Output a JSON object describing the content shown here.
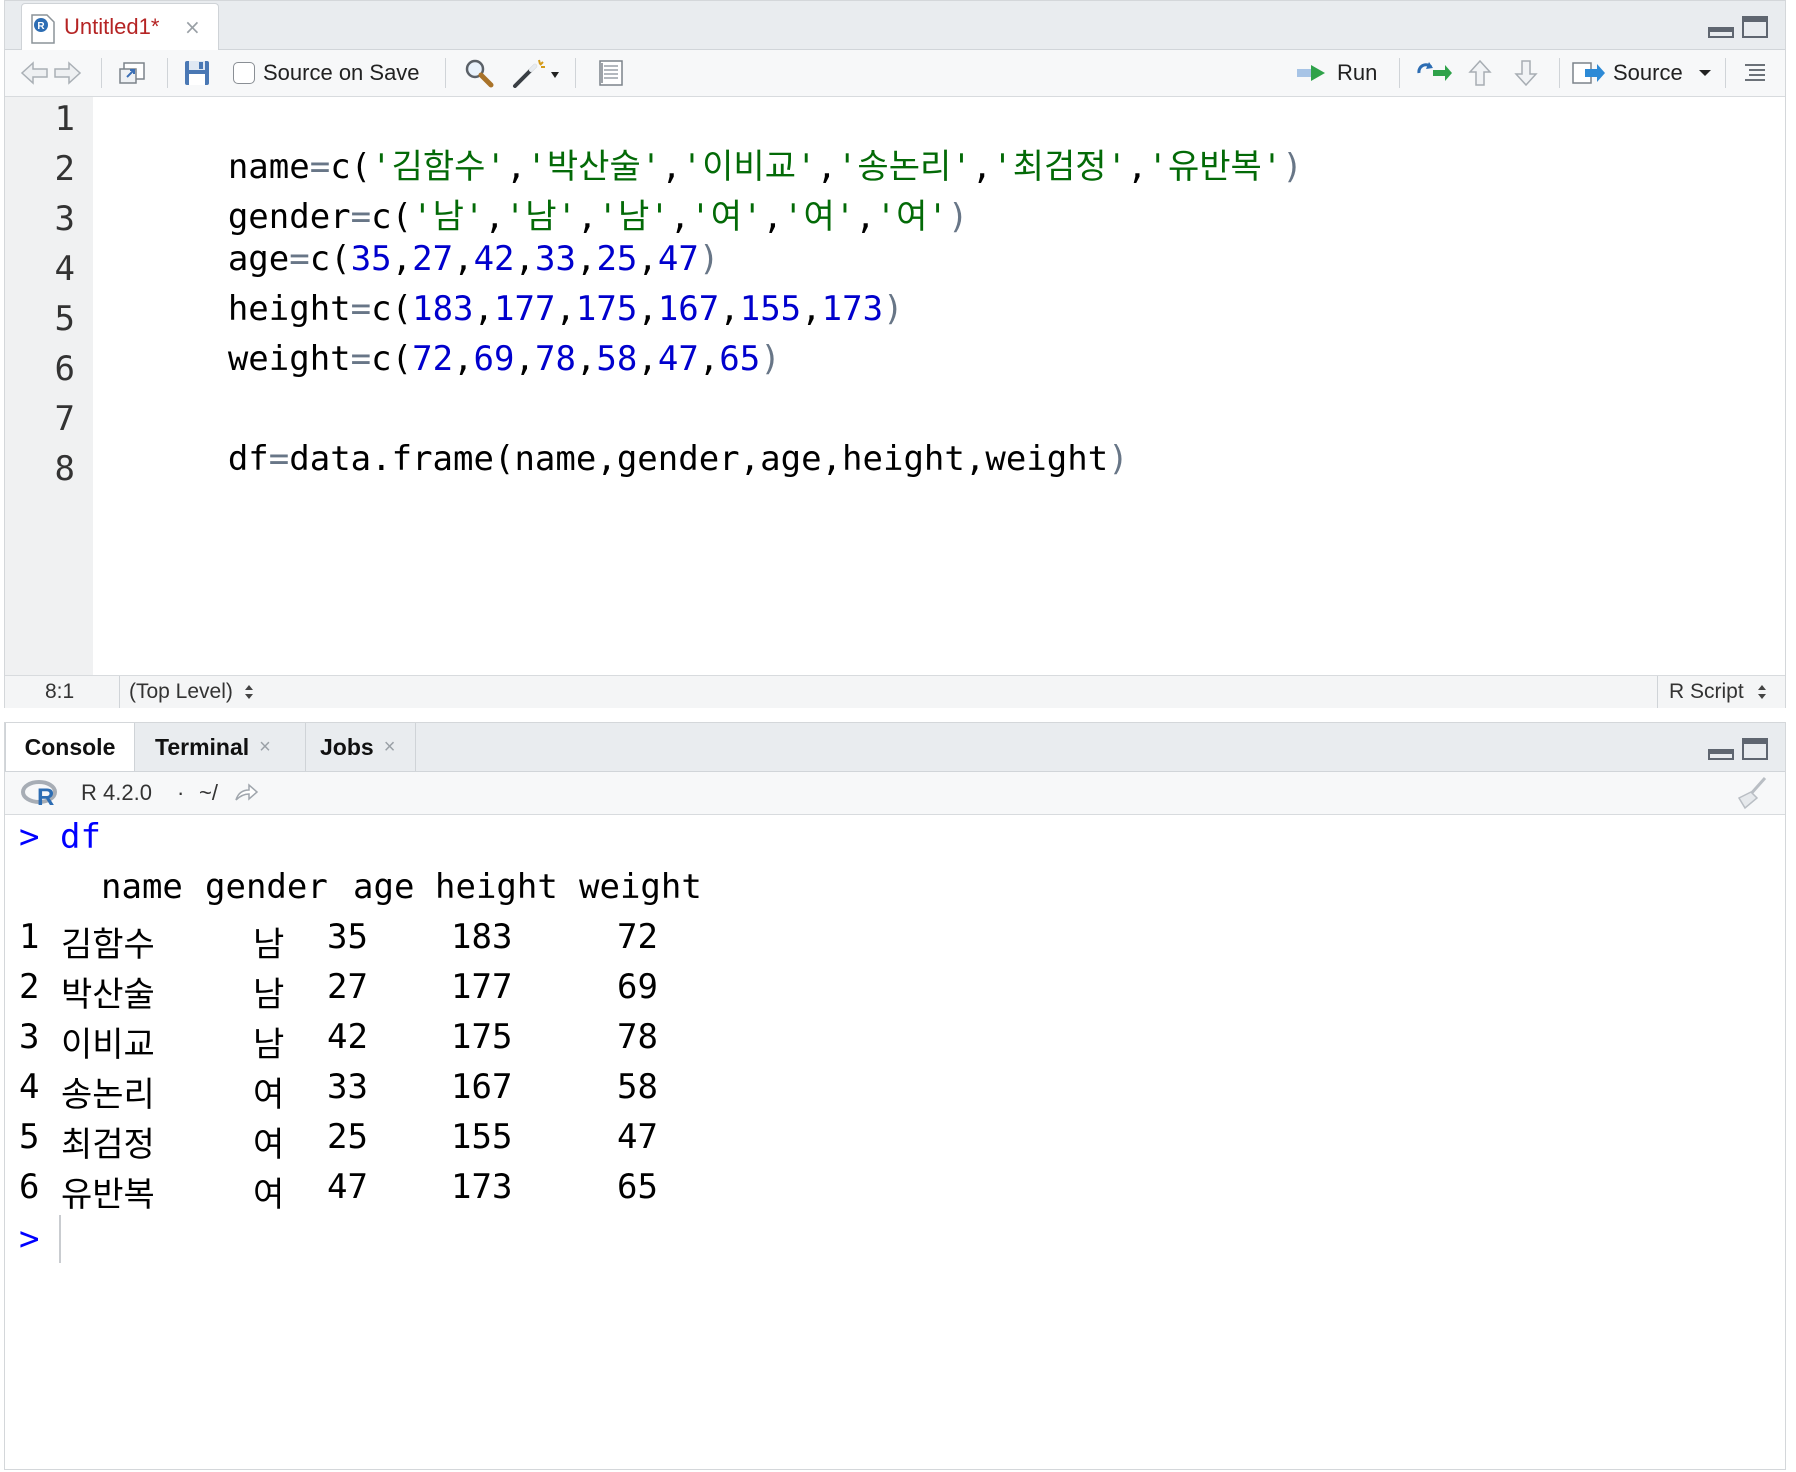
{
  "source_pane": {
    "tab": {
      "title": "Untitled1*",
      "close": "×"
    },
    "toolbar": {
      "source_on_save": "Source on Save",
      "run": "Run",
      "source": "Source"
    },
    "line_numbers": [
      "1",
      "2",
      "3",
      "4",
      "5",
      "6",
      "7",
      "8"
    ],
    "status": {
      "position": "8:1",
      "scope": "(Top Level)",
      "file_type": "R Script"
    }
  },
  "code": {
    "l1": {
      "a": "name",
      "b": "=",
      "c": "c(",
      "args": [
        "'김함수'",
        "'박산술'",
        "'이비교'",
        "'송논리'",
        "'최검정'",
        "'유반복'"
      ],
      "end": ")"
    },
    "l2": {
      "a": "gender",
      "b": "=",
      "c": "c(",
      "args": [
        "'남'",
        "'남'",
        "'남'",
        "'여'",
        "'여'",
        "'여'"
      ],
      "end": ")"
    },
    "l3": {
      "a": "age",
      "b": "=",
      "c": "c(",
      "args": [
        "35",
        "27",
        "42",
        "33",
        "25",
        "47"
      ],
      "end": ")"
    },
    "l4": {
      "a": "height",
      "b": "=",
      "c": "c(",
      "args": [
        "183",
        "177",
        "175",
        "167",
        "155",
        "173"
      ],
      "end": ")"
    },
    "l5": {
      "a": "weight",
      "b": "=",
      "c": "c(",
      "args": [
        "72",
        "69",
        "78",
        "58",
        "47",
        "65"
      ],
      "end": ")"
    },
    "l7": {
      "a": "df",
      "b": "=",
      "c": "data.frame(",
      "args": [
        "name",
        "gender",
        "age",
        "height",
        "weight"
      ],
      "end": ")"
    }
  },
  "console_pane": {
    "tabs": [
      {
        "label": "Console"
      },
      {
        "label": "Terminal",
        "close": "×"
      },
      {
        "label": "Jobs",
        "close": "×"
      }
    ],
    "r_version": "R 4.2.0",
    "dot": "·",
    "path": "~/",
    "prompt": ">",
    "command": "df",
    "table": {
      "headers": [
        "name",
        "gender",
        "age",
        "height",
        "weight"
      ],
      "rows": [
        {
          "idx": "1",
          "name": "김함수",
          "gender": "남",
          "age": "35",
          "height": "183",
          "weight": "72"
        },
        {
          "idx": "2",
          "name": "박산술",
          "gender": "남",
          "age": "27",
          "height": "177",
          "weight": "69"
        },
        {
          "idx": "3",
          "name": "이비교",
          "gender": "남",
          "age": "42",
          "height": "175",
          "weight": "78"
        },
        {
          "idx": "4",
          "name": "송논리",
          "gender": "여",
          "age": "33",
          "height": "167",
          "weight": "58"
        },
        {
          "idx": "5",
          "name": "최검정",
          "gender": "여",
          "age": "25",
          "height": "155",
          "weight": "47"
        },
        {
          "idx": "6",
          "name": "유반복",
          "gender": "여",
          "age": "47",
          "height": "173",
          "weight": "65"
        }
      ]
    }
  }
}
